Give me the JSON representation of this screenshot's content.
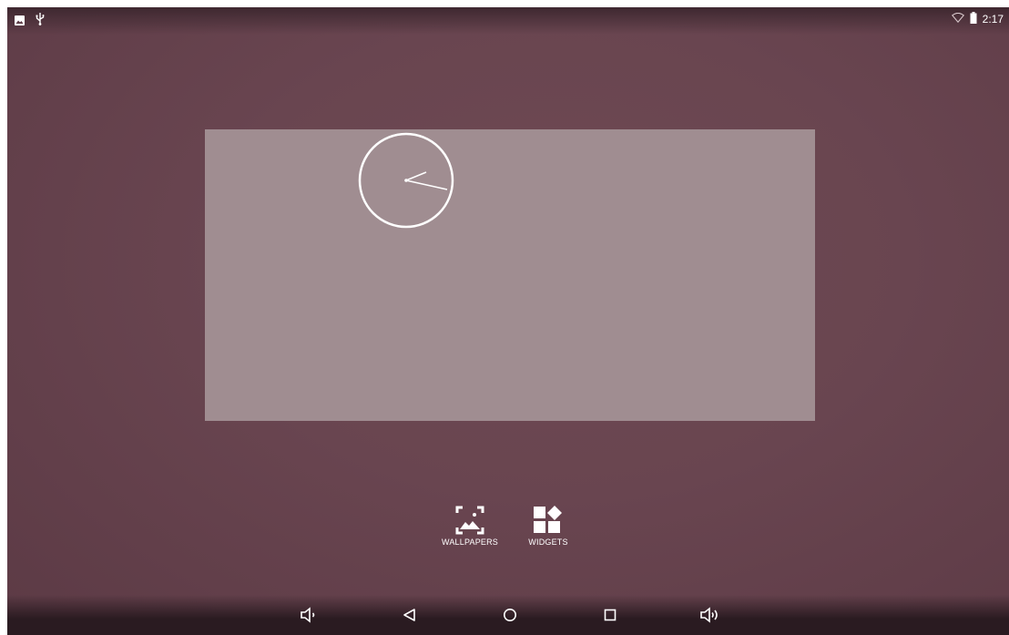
{
  "status_bar": {
    "left_icons": [
      "image-notification-icon",
      "usb-icon"
    ],
    "right_icons": [
      "wifi-icon",
      "battery-icon"
    ],
    "time": "2:17"
  },
  "home_page_preview": {
    "widget": "analog-clock-widget"
  },
  "overview_actions": {
    "wallpapers_label": "WALLPAPERS",
    "widgets_label": "WIDGETS"
  },
  "nav_bar": {
    "buttons": [
      "volume-down-icon",
      "back-icon",
      "home-icon",
      "recents-icon",
      "volume-up-icon"
    ]
  },
  "colors": {
    "wallpaper": "#6a4650",
    "preview_panel": "#a08d91",
    "foreground": "#ffffff"
  }
}
